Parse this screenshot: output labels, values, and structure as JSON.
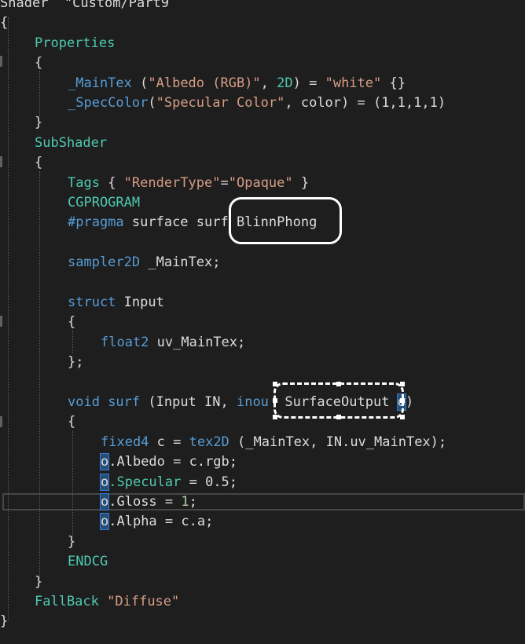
{
  "editor": {
    "lines": [
      {
        "indent": 0,
        "tokens": [
          {
            "t": "Shader  \"Custom/Part9",
            "c": "plain"
          }
        ]
      },
      {
        "indent": 0,
        "tokens": [
          {
            "t": "{",
            "c": "plain"
          }
        ]
      },
      {
        "indent": 44,
        "tokens": [
          {
            "t": "Properties",
            "c": "prop"
          }
        ]
      },
      {
        "indent": 44,
        "tokens": [
          {
            "t": "{",
            "c": "plain"
          }
        ]
      },
      {
        "indent": 86,
        "tokens": [
          {
            "t": "_MainTex",
            "c": "kw"
          },
          {
            "t": " (",
            "c": "plain"
          },
          {
            "t": "\"Albedo (RGB)\"",
            "c": "str"
          },
          {
            "t": ", ",
            "c": "plain"
          },
          {
            "t": "2D",
            "c": "prop"
          },
          {
            "t": ") = ",
            "c": "plain"
          },
          {
            "t": "\"white\"",
            "c": "str"
          },
          {
            "t": " {}",
            "c": "plain"
          }
        ]
      },
      {
        "indent": 86,
        "tokens": [
          {
            "t": "_SpecColor",
            "c": "kw"
          },
          {
            "t": "(",
            "c": "plain"
          },
          {
            "t": "\"Specular Color\"",
            "c": "str"
          },
          {
            "t": ", color) = (1,1,1,1)",
            "c": "plain"
          }
        ]
      },
      {
        "indent": 44,
        "tokens": [
          {
            "t": "}",
            "c": "plain"
          }
        ]
      },
      {
        "indent": 44,
        "tokens": [
          {
            "t": "SubShader",
            "c": "prop"
          }
        ]
      },
      {
        "indent": 44,
        "tokens": [
          {
            "t": "{",
            "c": "plain"
          }
        ]
      },
      {
        "indent": 86,
        "tokens": [
          {
            "t": "Tags",
            "c": "prop"
          },
          {
            "t": " { ",
            "c": "plain"
          },
          {
            "t": "\"RenderType\"",
            "c": "str"
          },
          {
            "t": "=",
            "c": "plain"
          },
          {
            "t": "\"Opaque\"",
            "c": "str"
          },
          {
            "t": " }",
            "c": "plain"
          }
        ]
      },
      {
        "indent": 86,
        "tokens": [
          {
            "t": "CGPROGRAM",
            "c": "prop"
          }
        ]
      },
      {
        "indent": 86,
        "tokens": [
          {
            "t": "#pragma",
            "c": "kw"
          },
          {
            "t": " surface surf ",
            "c": "plain"
          },
          {
            "t": "BlinnPhong",
            "c": "plain"
          }
        ]
      },
      {
        "indent": 86,
        "tokens": []
      },
      {
        "indent": 86,
        "tokens": [
          {
            "t": "sampler2D",
            "c": "kw"
          },
          {
            "t": " _MainTex;",
            "c": "plain"
          }
        ]
      },
      {
        "indent": 86,
        "tokens": []
      },
      {
        "indent": 86,
        "tokens": [
          {
            "t": "struct",
            "c": "kw"
          },
          {
            "t": " Input",
            "c": "plain"
          }
        ]
      },
      {
        "indent": 86,
        "tokens": [
          {
            "t": "{",
            "c": "plain"
          }
        ]
      },
      {
        "indent": 128,
        "tokens": [
          {
            "t": "float2",
            "c": "kw"
          },
          {
            "t": " uv_MainTex;",
            "c": "plain"
          }
        ]
      },
      {
        "indent": 86,
        "tokens": [
          {
            "t": "};",
            "c": "plain"
          }
        ]
      },
      {
        "indent": 86,
        "tokens": []
      },
      {
        "indent": 86,
        "tokens": [
          {
            "t": "void",
            "c": "kw"
          },
          {
            "t": " surf ",
            "c": "kw"
          },
          {
            "t": "(Input IN, ",
            "c": "plain"
          },
          {
            "t": "inou",
            "c": "kw"
          },
          {
            "t": "  SurfaceOutput ",
            "c": "plain"
          },
          {
            "t": "o",
            "c": "oref"
          },
          {
            "t": ")",
            "c": "plain"
          }
        ]
      },
      {
        "indent": 86,
        "tokens": [
          {
            "t": "{",
            "c": "plain"
          }
        ]
      },
      {
        "indent": 128,
        "tokens": [
          {
            "t": "fixed4",
            "c": "kw"
          },
          {
            "t": " c = ",
            "c": "plain"
          },
          {
            "t": "tex2D",
            "c": "kw"
          },
          {
            "t": " (_MainTex, IN.uv_MainTex);",
            "c": "plain"
          }
        ]
      },
      {
        "indent": 128,
        "tokens": [
          {
            "t": "o",
            "c": "oref"
          },
          {
            "t": ".Albedo = c.rgb;",
            "c": "plain"
          }
        ]
      },
      {
        "indent": 128,
        "tokens": [
          {
            "t": "o",
            "c": "oref"
          },
          {
            "t": ".Specular",
            "c": "prop"
          },
          {
            "t": " = 0.5;",
            "c": "plain"
          }
        ]
      },
      {
        "indent": 128,
        "tokens": [
          {
            "t": "o",
            "c": "oref"
          },
          {
            "t": ".Gloss = ",
            "c": "plain"
          },
          {
            "t": "1",
            "c": "num"
          },
          {
            "t": ";",
            "c": "plain"
          }
        ]
      },
      {
        "indent": 128,
        "tokens": [
          {
            "t": "o",
            "c": "oref"
          },
          {
            "t": ".Alpha = c.a;",
            "c": "plain"
          }
        ]
      },
      {
        "indent": 86,
        "tokens": [
          {
            "t": "}",
            "c": "plain"
          }
        ]
      },
      {
        "indent": 86,
        "tokens": [
          {
            "t": "ENDCG",
            "c": "prop"
          }
        ]
      },
      {
        "indent": 44,
        "tokens": [
          {
            "t": "}",
            "c": "plain"
          }
        ]
      },
      {
        "indent": 44,
        "tokens": [
          {
            "t": "FallBack",
            "c": "prop"
          },
          {
            "t": " ",
            "c": "plain"
          },
          {
            "t": "\"Diffuse\"",
            "c": "str"
          }
        ]
      },
      {
        "indent": 0,
        "tokens": [
          {
            "t": "}",
            "c": "plain"
          }
        ]
      }
    ]
  },
  "colors": {
    "background": "#1e1e1e",
    "keyword": "#569cd6",
    "type": "#4ec9b0",
    "string": "#d69d85",
    "number": "#b5cea8",
    "text": "#dcdcdc",
    "annotation": "#ffffff"
  }
}
